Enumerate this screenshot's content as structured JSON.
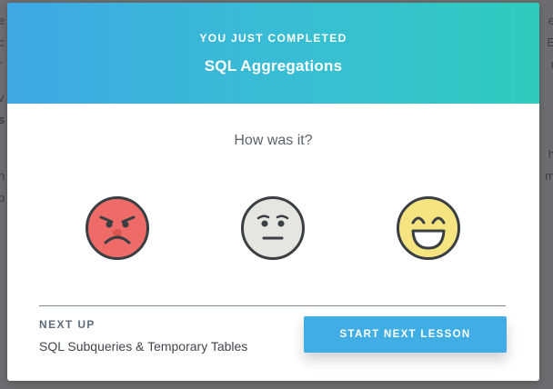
{
  "background": {
    "left_fragments": [
      "e",
      "c",
      "r",
      "v",
      "s",
      "i",
      "h",
      "p"
    ],
    "right_fragments": [
      "e",
      "E",
      "r",
      "h",
      "m"
    ]
  },
  "modal": {
    "eyebrow": "YOU JUST COMPLETED",
    "lesson_title": "SQL Aggregations",
    "question": "How was it?",
    "ratings": [
      {
        "name": "angry-face-icon",
        "color": "#ee6b67"
      },
      {
        "name": "neutral-face-icon",
        "color": "#e6e6e1"
      },
      {
        "name": "happy-face-icon",
        "color": "#f6e480"
      }
    ],
    "next": {
      "label": "NEXT UP",
      "title": "SQL Subqueries & Temporary Tables",
      "button_label": "START NEXT LESSON"
    }
  },
  "colors": {
    "header_start": "#3ea8e3",
    "header_end": "#2ecbbd",
    "button": "#40aee4"
  }
}
